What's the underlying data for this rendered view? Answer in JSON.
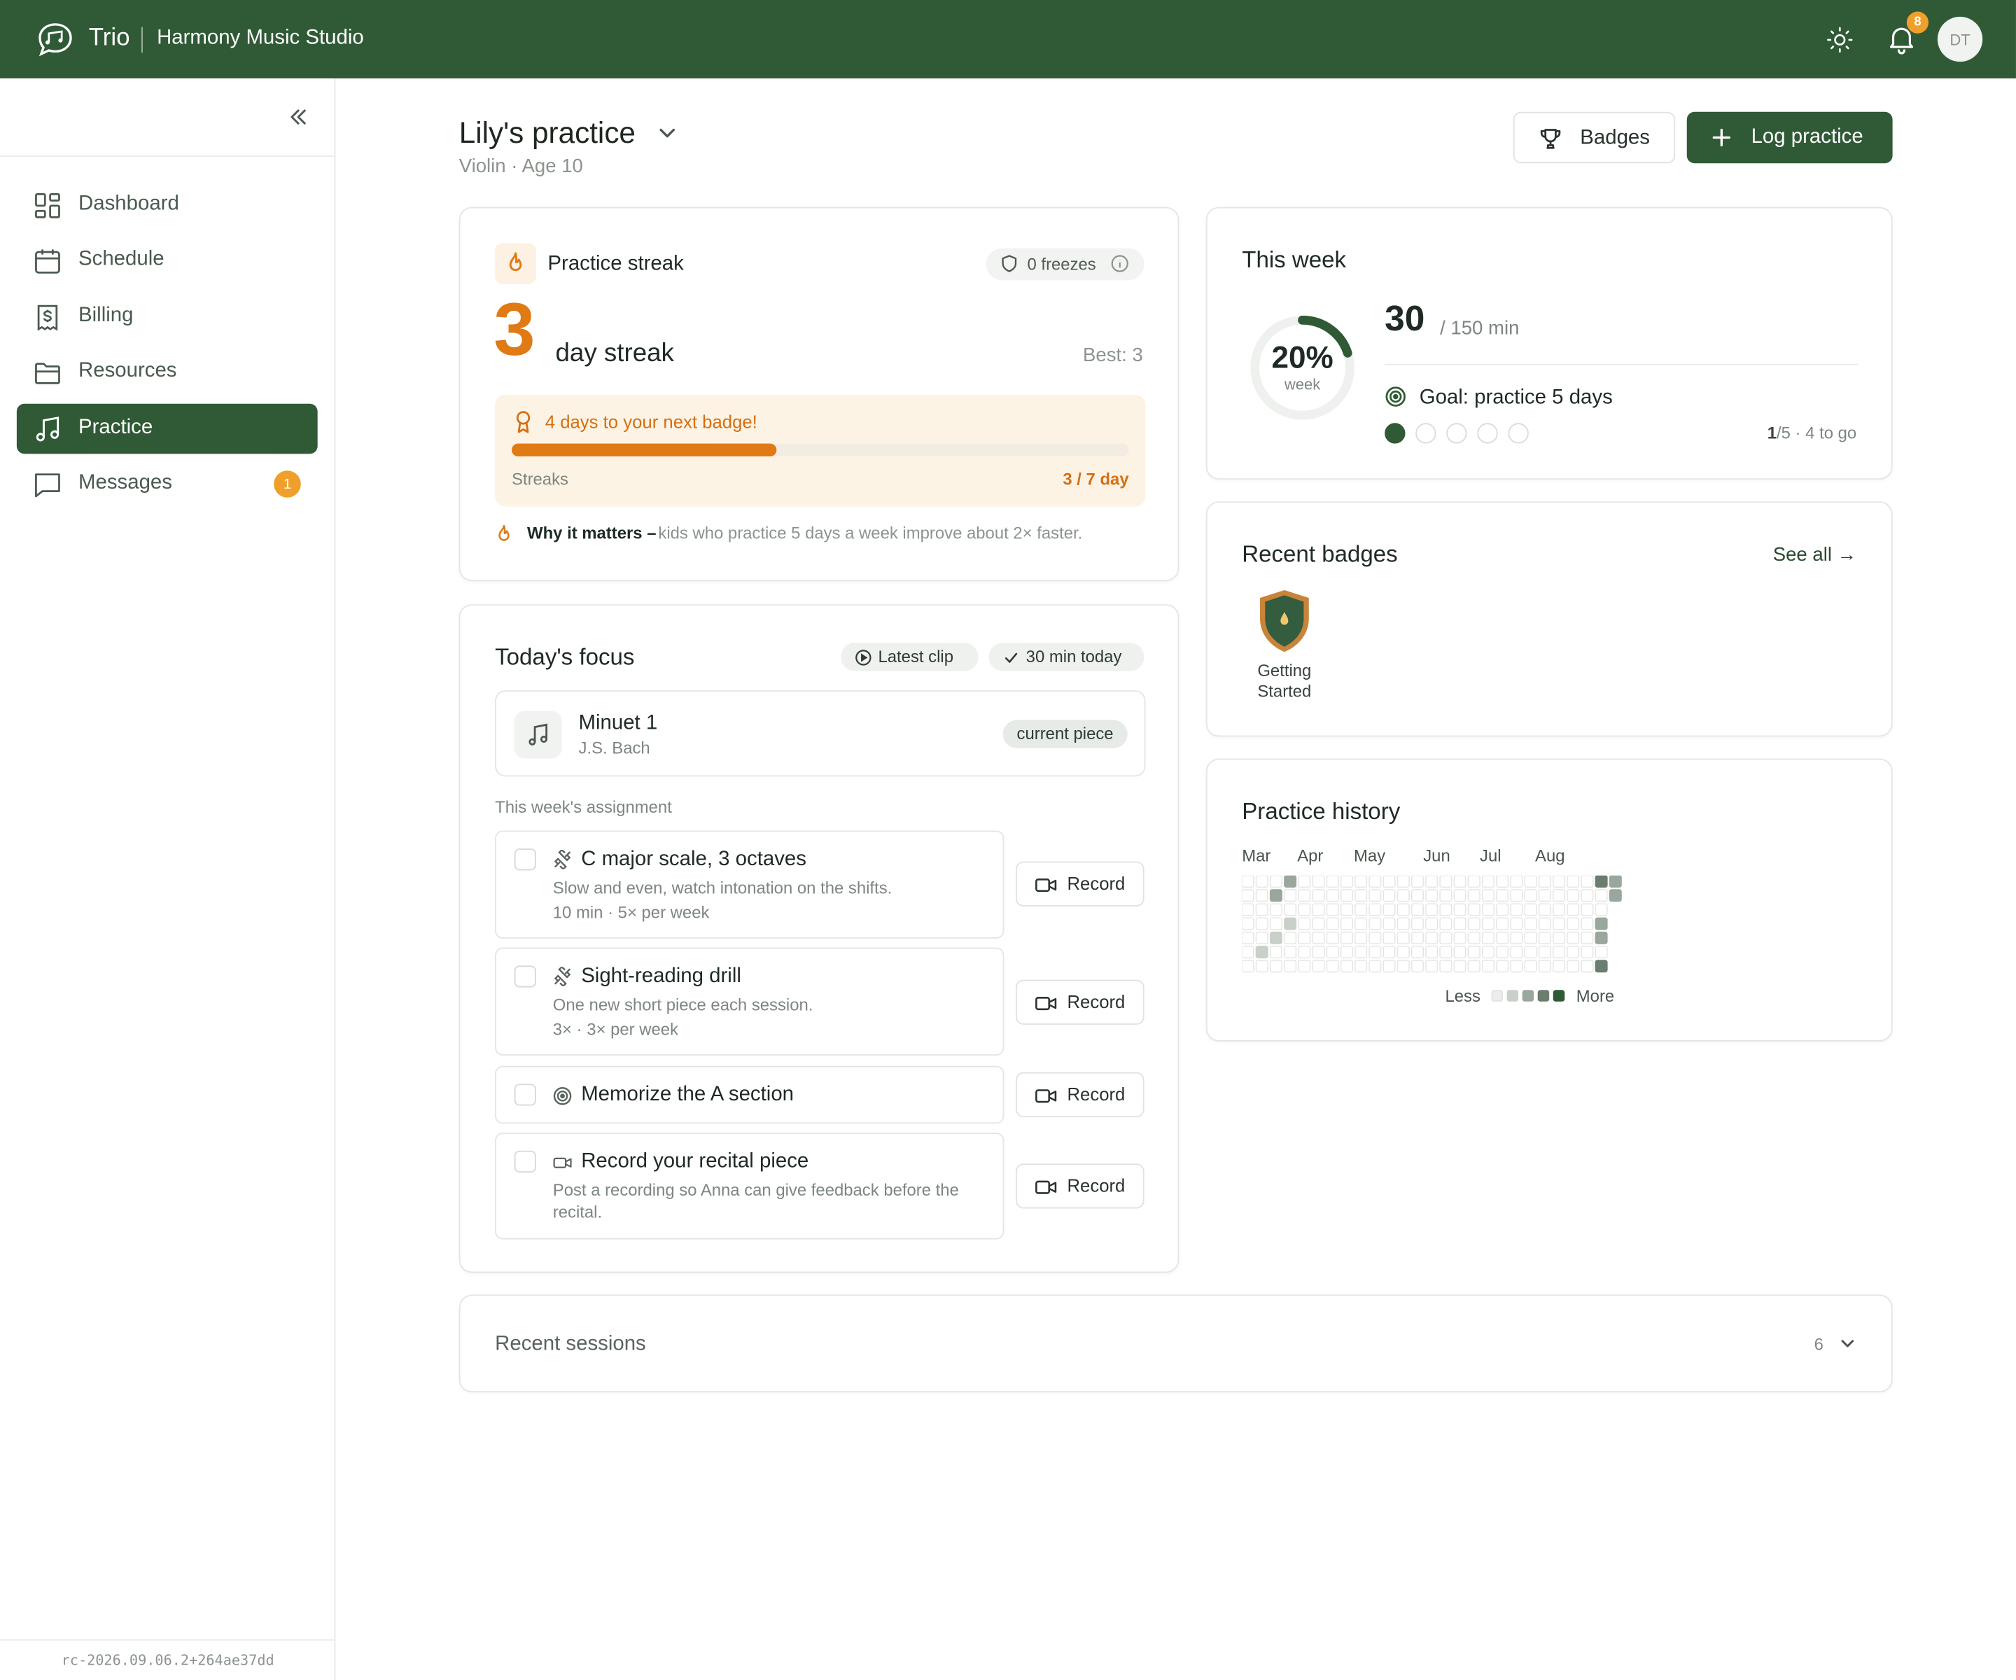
{
  "app": {
    "brand": "Trio",
    "studio": "Harmony Music Studio",
    "notification_count": "8",
    "avatar_initials": "DT",
    "version": "rc-2026.09.06.2+264ae37dd",
    "accent": "#2f5a35",
    "orange": "#e07a14"
  },
  "sidebar": {
    "items": [
      {
        "label": "Dashboard",
        "icon": "dashboard-icon"
      },
      {
        "label": "Schedule",
        "icon": "calendar-icon"
      },
      {
        "label": "Billing",
        "icon": "billing-icon"
      },
      {
        "label": "Resources",
        "icon": "folder-icon"
      },
      {
        "label": "Practice",
        "icon": "music-note-icon",
        "active": true
      },
      {
        "label": "Messages",
        "icon": "message-icon",
        "badge": "1"
      }
    ]
  },
  "header": {
    "title": "Lily's practice",
    "subtitle": "Violin · Age 10",
    "badges_label": "Badges",
    "log_label": "Log practice"
  },
  "streak": {
    "label": "Practice streak",
    "freezes": "0 freezes",
    "count": "3",
    "unit": "day streak",
    "best": "Best: 3",
    "next_badge": "4 days to your next badge!",
    "progress_fraction": 0.43,
    "kind": "Streaks",
    "progress_text": "3 / 7 day",
    "why_title": "Why it matters –",
    "why_text": "kids who practice 5 days a week improve about 2× faster."
  },
  "week": {
    "title": "This week",
    "percent_text": "20%",
    "percent_value": 0.2,
    "percent_sub": "week",
    "minutes": "30",
    "of_minutes": "/ 150 min",
    "goal": "Goal: practice 5 days",
    "days_done": 1,
    "days_total": 5,
    "count_done": "1",
    "count_rest": "/5 · 4 to go"
  },
  "badges": {
    "title": "Recent badges",
    "see_all": "See all →",
    "items": [
      {
        "name": "Getting Started"
      }
    ]
  },
  "history": {
    "title": "Practice history",
    "months": [
      "Mar",
      "Apr",
      "May",
      "Jun",
      "Jul",
      "Aug"
    ],
    "less": "Less",
    "more": "More"
  },
  "focus": {
    "title": "Today's focus",
    "latest_clip": "Latest clip",
    "minutes_today": "30 min today",
    "piece_name": "Minuet 1",
    "piece_composer": "J.S. Bach",
    "piece_tag": "current piece",
    "assignment_label": "This week's assignment",
    "record_label": "Record",
    "tasks": [
      {
        "name": "C major scale, 3 octaves",
        "desc": "Slow and even, watch intonation on the shifts.",
        "meta": "10 min · 5× per week"
      },
      {
        "name": "Sight-reading drill",
        "desc": "One new short piece each session.",
        "meta": "3× · 3× per week"
      },
      {
        "name": "Memorize the A section",
        "desc": "",
        "meta": ""
      },
      {
        "name": "Record your recital piece",
        "desc": "Post a recording so Anna can give feedback before the recital.",
        "meta": ""
      }
    ]
  },
  "sessions": {
    "title": "Recent sessions",
    "count": "6"
  }
}
